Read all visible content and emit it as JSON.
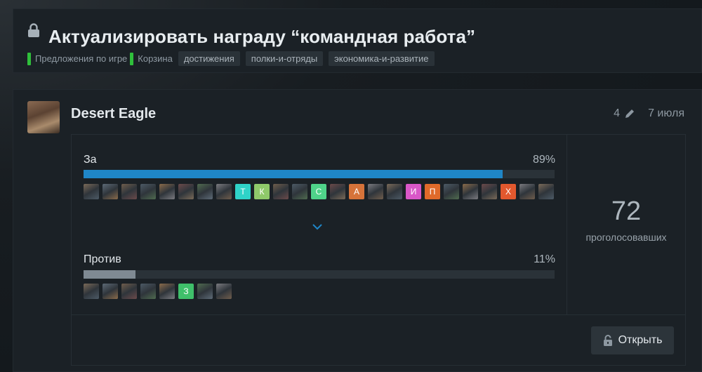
{
  "thread": {
    "title": "Актуализировать награду “командная работа”",
    "categories": [
      "Предложения по игре",
      "Корзина"
    ],
    "tags": [
      "достижения",
      "полки-и-отряды",
      "экономика-и-развитие"
    ]
  },
  "post": {
    "author": "Desert Eagle",
    "edit_count": "4",
    "date": "7 июля"
  },
  "poll": {
    "options": [
      {
        "label": "За",
        "percent_label": "89%",
        "percent": 89,
        "voters": [
          {
            "type": "img"
          },
          {
            "type": "img"
          },
          {
            "type": "img"
          },
          {
            "type": "img"
          },
          {
            "type": "img"
          },
          {
            "type": "img"
          },
          {
            "type": "img"
          },
          {
            "type": "img"
          },
          {
            "type": "letter",
            "letter": "Т",
            "color": "#2fd3c8"
          },
          {
            "type": "letter",
            "letter": "К",
            "color": "#8fc96a"
          },
          {
            "type": "img"
          },
          {
            "type": "img"
          },
          {
            "type": "letter",
            "letter": "С",
            "color": "#4fd38a"
          },
          {
            "type": "img"
          },
          {
            "type": "letter",
            "letter": "А",
            "color": "#d6733a"
          },
          {
            "type": "img"
          },
          {
            "type": "img"
          },
          {
            "type": "letter",
            "letter": "И",
            "color": "#d957c8"
          },
          {
            "type": "letter",
            "letter": "П",
            "color": "#e06a2a"
          },
          {
            "type": "img"
          },
          {
            "type": "img"
          },
          {
            "type": "img"
          },
          {
            "type": "letter",
            "letter": "Х",
            "color": "#e2582e"
          },
          {
            "type": "img"
          },
          {
            "type": "img"
          }
        ]
      },
      {
        "label": "Против",
        "percent_label": "11%",
        "percent": 11,
        "voters": [
          {
            "type": "img"
          },
          {
            "type": "img"
          },
          {
            "type": "img"
          },
          {
            "type": "img"
          },
          {
            "type": "img"
          },
          {
            "type": "letter",
            "letter": "З",
            "color": "#3fbf6a"
          },
          {
            "type": "img"
          },
          {
            "type": "img"
          }
        ]
      }
    ],
    "total_votes": "72",
    "total_label": "проголосовавших",
    "open_button": "Открыть"
  },
  "colors": {
    "accent_bar": "#1f86c7",
    "minor_bar": "#7f8a93",
    "category_marker": "#2fbf3b"
  },
  "icons": [
    "lock-icon",
    "pencil-icon",
    "chevron-down-icon",
    "unlock-icon"
  ]
}
